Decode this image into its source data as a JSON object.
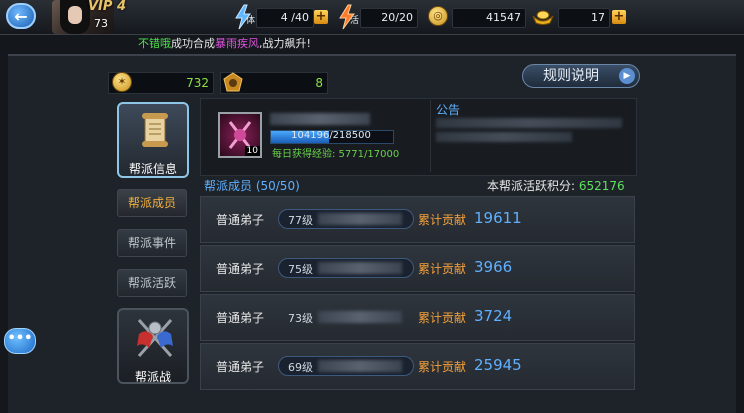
{
  "top": {
    "vip": "VIP 4",
    "level": "73",
    "stamina": {
      "label": "体",
      "value": "4 /40"
    },
    "vitality": {
      "label": "活",
      "value": "20/20"
    },
    "coins": "41547",
    "gold": "17",
    "ticker": {
      "name": "不错哦",
      "mid": "成功合成",
      "item": "暴雨疾风",
      "tail": ",战力飙升!"
    }
  },
  "stats": {
    "coin_val": "732",
    "rank_val": "8"
  },
  "rules_label": "规则说明",
  "sidebar": {
    "info": "帮派信息",
    "members": "帮派成员",
    "events": "帮派事件",
    "activity": "帮派活跃",
    "war": "帮派战"
  },
  "guild": {
    "badge_level": "10",
    "exp": "104196/218500",
    "exp_fraction": 0.477,
    "daily": "每日获得经验: 5771/17000",
    "notice_title": "公告"
  },
  "members_header": {
    "label": "帮派成员 (50/50)",
    "score_label": "本帮派活跃积分:",
    "score_value": "652176"
  },
  "contrib_label": "累计贡献",
  "members": [
    {
      "role": "普通弟子",
      "level": "77级",
      "contrib": "19611",
      "pill": true
    },
    {
      "role": "普通弟子",
      "level": "75级",
      "contrib": "3966",
      "pill": true
    },
    {
      "role": "普通弟子",
      "level": "73级",
      "contrib": "3724",
      "pill": false
    },
    {
      "role": "普通弟子",
      "level": "69级",
      "contrib": "25945",
      "pill": true
    }
  ],
  "colors": {
    "accent_blue": "#5fb0ff",
    "green": "#8ce04a",
    "orange": "#f3a03a"
  }
}
